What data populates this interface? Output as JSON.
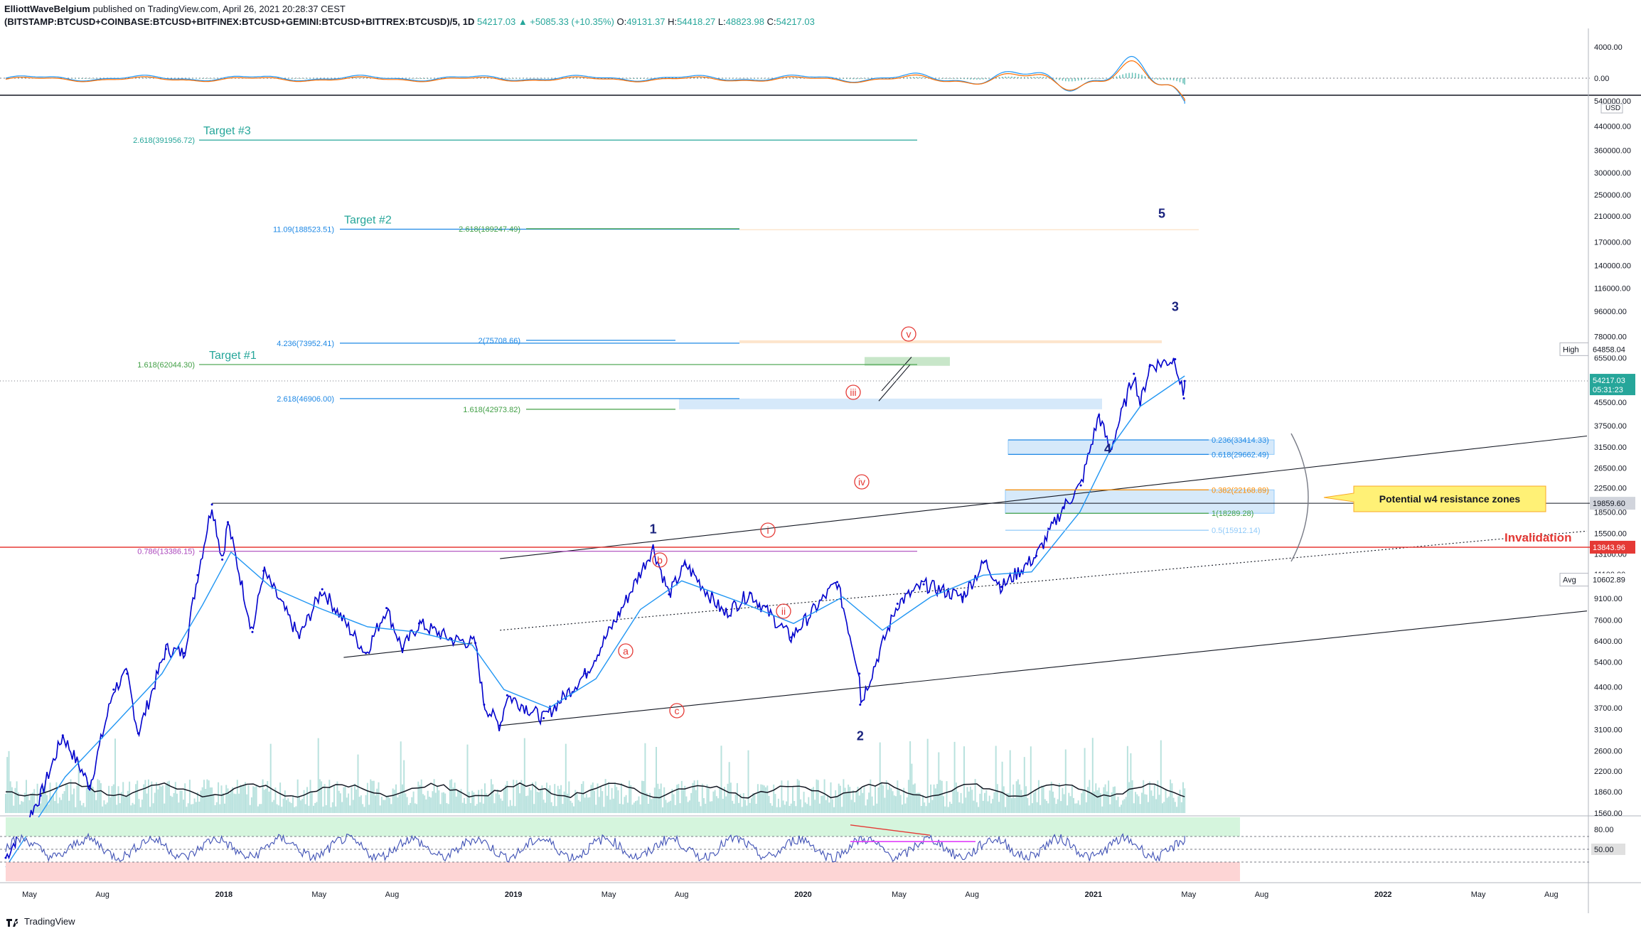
{
  "header": {
    "author": "ElliottWaveBelgium",
    "published": "published on TradingView.com, April 26, 2021 20:28:37 CEST",
    "symbol": "(BITSTAMP:BTCUSD+COINBASE:BTCUSD+BITFINEX:BTCUSD+GEMINI:BTCUSD+BITTREX:BTCUSD)/5, 1D",
    "last": "54217.03",
    "change": "▲ +5085.33 (+10.35%)",
    "o_label": "O:",
    "o": "49131.37",
    "h_label": "H:",
    "h": "54418.27",
    "l_label": "L:",
    "l": "48823.98",
    "c_label": "C:",
    "c": "54217.03"
  },
  "footer": {
    "brand": "TradingView"
  },
  "colors": {
    "price": "#0000cc",
    "ema": "#2196f3",
    "accent_red": "#e53935",
    "wave_blue": "#1a237e",
    "fib_blue": "#1e88e5",
    "fib_green": "#43a047"
  },
  "chart_data": {
    "type": "line",
    "title": "",
    "scale": "log",
    "ylim": [
      1560,
      560000
    ],
    "xlim": [
      "2017-04-01",
      "2022-09-15"
    ],
    "price_axis_ticks": [
      1560,
      1860,
      2200,
      2600,
      3100,
      3700,
      4400,
      5400,
      6400,
      7600,
      9100,
      11100,
      13100,
      15500,
      18500,
      22500,
      26500,
      31500,
      37500,
      45500,
      54500,
      65500,
      78000,
      96000,
      116000,
      140000,
      170000,
      210000,
      250000,
      300000,
      360000,
      440000,
      540000
    ],
    "price_axis_unit": "USD",
    "time_axis_ticks": [
      {
        "label": "May",
        "date": "2017-05-01"
      },
      {
        "label": "Aug",
        "date": "2017-08-01"
      },
      {
        "label": "2018",
        "date": "2018-01-01"
      },
      {
        "label": "May",
        "date": "2018-05-01"
      },
      {
        "label": "Aug",
        "date": "2018-08-01"
      },
      {
        "label": "2019",
        "date": "2019-01-01"
      },
      {
        "label": "May",
        "date": "2019-05-01"
      },
      {
        "label": "Aug",
        "date": "2019-08-01"
      },
      {
        "label": "2020",
        "date": "2020-01-01"
      },
      {
        "label": "May",
        "date": "2020-05-01"
      },
      {
        "label": "Aug",
        "date": "2020-08-01"
      },
      {
        "label": "2021",
        "date": "2021-01-01"
      },
      {
        "label": "May",
        "date": "2021-05-01"
      },
      {
        "label": "Aug",
        "date": "2021-08-01"
      },
      {
        "label": "2022",
        "date": "2022-01-01"
      },
      {
        "label": "May",
        "date": "2022-05-01"
      },
      {
        "label": "Aug",
        "date": "2022-08-01"
      }
    ],
    "series": [
      {
        "name": "",
        "color": "#0000cc",
        "points": [
          [
            "2017-04-01",
            1080
          ],
          [
            "2017-05-15",
            1800
          ],
          [
            "2017-06-12",
            2950
          ],
          [
            "2017-07-16",
            1950
          ],
          [
            "2017-08-15",
            4300
          ],
          [
            "2017-09-01",
            4900
          ],
          [
            "2017-09-15",
            3000
          ],
          [
            "2017-10-20",
            6000
          ],
          [
            "2017-11-12",
            5800
          ],
          [
            "2017-11-29",
            11000
          ],
          [
            "2017-12-17",
            19650
          ],
          [
            "2017-12-30",
            12500
          ],
          [
            "2018-01-06",
            17000
          ],
          [
            "2018-02-06",
            6900
          ],
          [
            "2018-02-20",
            11400
          ],
          [
            "2018-04-06",
            6600
          ],
          [
            "2018-05-05",
            9800
          ],
          [
            "2018-06-29",
            5800
          ],
          [
            "2018-07-25",
            8400
          ],
          [
            "2018-08-14",
            6000
          ],
          [
            "2018-09-04",
            7400
          ],
          [
            "2018-10-15",
            6500
          ],
          [
            "2018-11-14",
            6300
          ],
          [
            "2018-11-25",
            3800
          ],
          [
            "2018-12-15",
            3200
          ],
          [
            "2018-12-24",
            4100
          ],
          [
            "2019-02-08",
            3400
          ],
          [
            "2019-04-02",
            4900
          ],
          [
            "2019-05-14",
            8000
          ],
          [
            "2019-06-26",
            13800
          ],
          [
            "2019-07-16",
            9400
          ],
          [
            "2019-08-06",
            12000
          ],
          [
            "2019-09-24",
            8000
          ],
          [
            "2019-10-26",
            9500
          ],
          [
            "2019-12-17",
            6600
          ],
          [
            "2020-02-13",
            10400
          ],
          [
            "2020-03-12",
            4900
          ],
          [
            "2020-03-13",
            3800
          ],
          [
            "2020-04-29",
            8700
          ],
          [
            "2020-06-01",
            10200
          ],
          [
            "2020-07-20",
            9200
          ],
          [
            "2020-08-17",
            12300
          ],
          [
            "2020-09-07",
            10000
          ],
          [
            "2020-10-21",
            12900
          ],
          [
            "2020-11-24",
            19200
          ],
          [
            "2020-12-16",
            23000
          ],
          [
            "2021-01-08",
            41000
          ],
          [
            "2021-01-22",
            30500
          ],
          [
            "2021-02-21",
            57500
          ],
          [
            "2021-03-01",
            45000
          ],
          [
            "2021-03-13",
            61200
          ],
          [
            "2021-04-14",
            64800
          ],
          [
            "2021-04-25",
            47000
          ],
          [
            "2021-04-26",
            54217
          ]
        ]
      },
      {
        "name": "",
        "color": "#2196f3",
        "points": [
          [
            "2017-04-01",
            1000
          ],
          [
            "2017-06-15",
            2100
          ],
          [
            "2017-08-15",
            3200
          ],
          [
            "2017-10-15",
            4900
          ],
          [
            "2017-12-05",
            8600
          ],
          [
            "2018-01-10",
            13300
          ],
          [
            "2018-03-01",
            10000
          ],
          [
            "2018-05-01",
            8400
          ],
          [
            "2018-07-01",
            7200
          ],
          [
            "2018-09-01",
            6900
          ],
          [
            "2018-11-10",
            6200
          ],
          [
            "2018-12-20",
            4300
          ],
          [
            "2019-02-15",
            3700
          ],
          [
            "2019-04-15",
            4700
          ],
          [
            "2019-06-10",
            8300
          ],
          [
            "2019-08-01",
            10500
          ],
          [
            "2019-10-15",
            8800
          ],
          [
            "2019-12-20",
            7400
          ],
          [
            "2020-02-20",
            9200
          ],
          [
            "2020-04-10",
            7000
          ],
          [
            "2020-06-10",
            9200
          ],
          [
            "2020-08-15",
            11000
          ],
          [
            "2020-10-15",
            11300
          ],
          [
            "2020-12-15",
            18500
          ],
          [
            "2021-01-25",
            32000
          ],
          [
            "2021-03-01",
            44000
          ],
          [
            "2021-04-26",
            56500
          ]
        ]
      }
    ],
    "levels": [
      {
        "label": "2.618(391956.72)",
        "value": 391956.72
      },
      {
        "label": "11.09(188523.51)",
        "value": 188523.51
      },
      {
        "label": "2.618(189247.49)",
        "value": 189247.49
      },
      {
        "label": "4.236(73952.41)",
        "value": 73952.41
      },
      {
        "label": "2(75708.66)",
        "value": 75708.66
      },
      {
        "label": "1.618(62044.30)",
        "value": 62044.3
      },
      {
        "label": "2.618(46906.00)",
        "value": 46906.0
      },
      {
        "label": "1.618(42973.82)",
        "value": 42973.82
      },
      {
        "label": "0.786(13386.15)",
        "value": 13386.15
      },
      {
        "label": "0.236(33414.33)",
        "value": 33414.33
      },
      {
        "label": "0.618(29662.49)",
        "value": 29662.49
      },
      {
        "label": "0.382(22168.89)",
        "value": 22168.89
      },
      {
        "label": "1(18289.28)",
        "value": 18289.28
      },
      {
        "label": "0.5(15912.14)",
        "value": 15912.14
      }
    ],
    "targets": [
      "Target #3",
      "Target #2",
      "Target #1"
    ],
    "wave_labels_primary": [
      "1",
      "2",
      "3",
      "4",
      "5"
    ],
    "wave_labels_minor": [
      "i",
      "ii",
      "iii",
      "iv",
      "v"
    ],
    "wave_labels_corrective": [
      "a",
      "b",
      "c"
    ],
    "annotations": {
      "callout": "Potential w4 resistance zones",
      "invalidation": "Invalidation"
    },
    "price_tags": {
      "high_label": "High",
      "high": "64858.04",
      "last": "54217.03",
      "countdown": "05:31:23",
      "level_1": "19859.60",
      "invalidation": "13843.96",
      "avg_label": "Avg",
      "avg": "10602.89"
    },
    "macd_axis_ticks": [
      "4000.00",
      "0.00"
    ],
    "rsi_axis_ticks": [
      "80.00",
      "50.00"
    ],
    "rsi_bands": {
      "upper": 70,
      "mid": 50,
      "lower": 30
    }
  }
}
